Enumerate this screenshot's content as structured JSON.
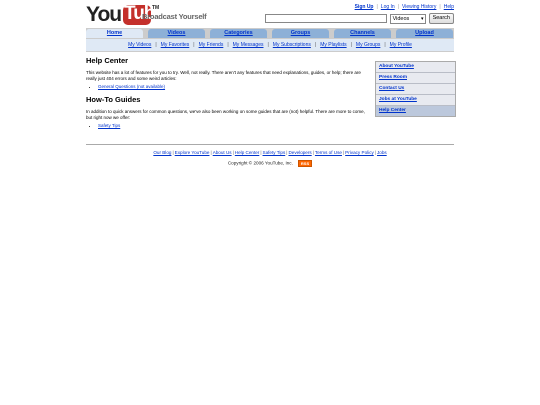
{
  "header": {
    "logo_you": "You",
    "logo_tube": "Tube",
    "logo_tm": "TM",
    "tagline": "Broadcast Yourself",
    "top_links": [
      "Sign Up",
      "Log In",
      "Viewing History",
      "Help"
    ],
    "search": {
      "value": "",
      "category": "Videos",
      "button": "Search"
    }
  },
  "nav": {
    "tabs": [
      "Home",
      "Videos",
      "Categories",
      "Groups",
      "Channels",
      "Upload"
    ],
    "active_tab": "Home",
    "subnav": [
      "My Videos",
      "My Favorites",
      "My Friends",
      "My Messages",
      "My Subscriptions",
      "My Playlists",
      "My Groups",
      "My Profile"
    ]
  },
  "main": {
    "title": "Help Center",
    "intro": "This website has a lot of features for you to try. Well, not really. There aren't any features that need explanations, guides, or help; there are really just 404 errors and some weird articles:",
    "intro_links": [
      "General Questions (not available)"
    ],
    "guides_title": "How-To Guides",
    "guides_text": "In addition to quick answers for common questions, we've also been working on some guides that are (not) helpful. There are more to come, but right now we offer:",
    "guides_links": [
      "Safety Tips"
    ]
  },
  "sidebar": {
    "items": [
      "About YouTube",
      "Press Room",
      "Contact Us",
      "Jobs at YouTube",
      "Help Center"
    ],
    "active": "Help Center"
  },
  "footer": {
    "links": [
      "Our Blog",
      "Explore YouTube",
      "About Us",
      "Help Center",
      "Safety Tips",
      "Developers",
      "Terms of Use",
      "Privacy Policy",
      "Jobs"
    ],
    "copyright": "Copyright © 2006 YouTube, Inc.",
    "rss": "RSS"
  },
  "colors": {
    "link": "#0033cc",
    "tab": "#8db0d7",
    "subnav_bg": "#dfe9f5",
    "logo_red": "#c4302b",
    "rss": "#ff6600"
  }
}
